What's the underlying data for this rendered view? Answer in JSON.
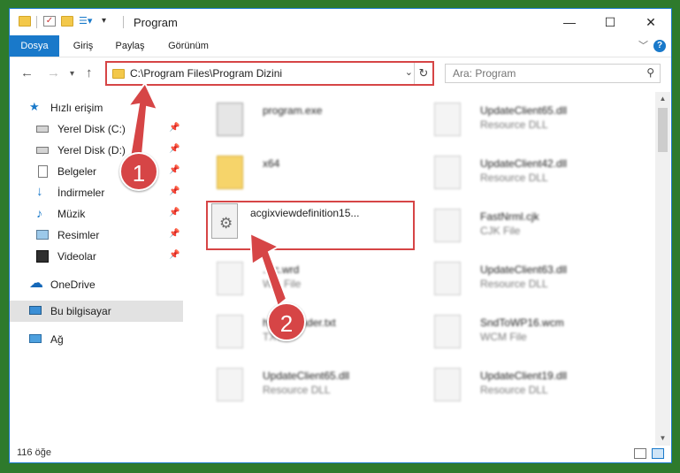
{
  "window": {
    "title": "Program"
  },
  "ribbon": {
    "tabs": [
      "Dosya",
      "Giriş",
      "Paylaş",
      "Görünüm"
    ],
    "help": "?"
  },
  "nav": {
    "address": "C:\\Program Files\\Program Dizini",
    "search_placeholder": "Ara: Program"
  },
  "sidebar": {
    "items": [
      {
        "label": "Hızlı erişim",
        "icon": "star-icon",
        "pinned": false
      },
      {
        "label": "Yerel Disk (C:)",
        "icon": "drive-icon",
        "pinned": true
      },
      {
        "label": "Yerel Disk (D:)",
        "icon": "drive-icon",
        "pinned": true
      },
      {
        "label": "Belgeler",
        "icon": "documents-icon",
        "pinned": true
      },
      {
        "label": "İndirmeler",
        "icon": "download-arrow-icon",
        "pinned": true
      },
      {
        "label": "Müzik",
        "icon": "music-note-icon",
        "pinned": true
      },
      {
        "label": "Resimler",
        "icon": "pictures-icon",
        "pinned": true
      },
      {
        "label": "Videolar",
        "icon": "film-icon",
        "pinned": true
      },
      {
        "label": "OneDrive",
        "icon": "cloud-icon",
        "pinned": false
      },
      {
        "label": "Bu bilgisayar",
        "icon": "monitor-icon",
        "pinned": false
      },
      {
        "label": "Ağ",
        "icon": "network-icon",
        "pinned": false
      }
    ]
  },
  "files": [
    {
      "name": "program.exe",
      "type": ""
    },
    {
      "name": "UpdateClient65.dll",
      "type": "Resource DLL"
    },
    {
      "name": "x64",
      "type": ""
    },
    {
      "name": "UpdateClient42.dll",
      "type": "Resource DLL"
    },
    {
      "name": "acgixviewdefinition15...",
      "type": ""
    },
    {
      "name": "FastNrml.cjk",
      "type": "CJK File"
    },
    {
      "name": "...ic.wrd",
      "type": "W... File"
    },
    {
      "name": "UpdateClient63.dll",
      "type": "Resource DLL"
    },
    {
      "name": "help...reader.txt",
      "type": "TXT..."
    },
    {
      "name": "SndToWP16.wcm",
      "type": "WCM File"
    },
    {
      "name": "UpdateClient65.dll",
      "type": "Resource DLL"
    },
    {
      "name": "UpdateClient19.dll",
      "type": "Resource DLL"
    }
  ],
  "status": {
    "count": "116 öğe"
  },
  "annotations": {
    "marker1": "1",
    "marker2": "2",
    "color": "#d64546"
  },
  "colors": {
    "accent": "#1979ca",
    "highlight": "#d64546",
    "folder": "#f3c84a"
  }
}
